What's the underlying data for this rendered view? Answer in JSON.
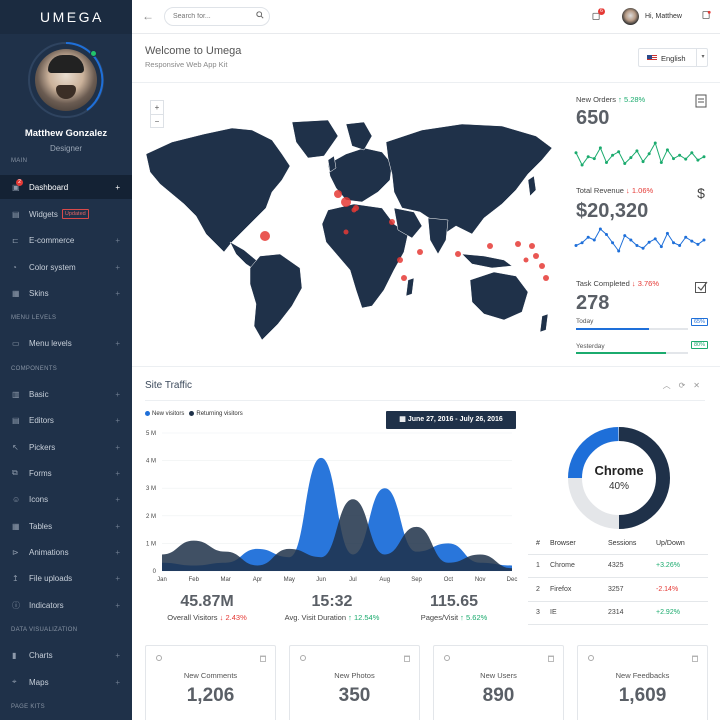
{
  "brand": "UMEGA",
  "profile": {
    "name": "Matthew Gonzalez",
    "role": "Designer"
  },
  "sidebar": {
    "sections": {
      "main": "MAIN",
      "menu_levels": "MENU LEVELS",
      "components": "COMPONENTS",
      "data_visualization": "DATA VISUALIZATION",
      "page_kits": "PAGE KITS"
    },
    "items": [
      {
        "label": "Dashboard",
        "icon": "dashboard-icon",
        "badge": "2",
        "active": true
      },
      {
        "label": "Widgets",
        "icon": "widgets-icon",
        "tag": "Updated"
      },
      {
        "label": "E-commerce",
        "icon": "cart-icon"
      },
      {
        "label": "Color system",
        "icon": "palette-icon"
      },
      {
        "label": "Skins",
        "icon": "skins-icon"
      },
      {
        "label": "Menu levels",
        "icon": "folder-icon"
      },
      {
        "label": "Basic",
        "icon": "basic-icon"
      },
      {
        "label": "Editors",
        "icon": "editor-icon"
      },
      {
        "label": "Pickers",
        "icon": "picker-icon"
      },
      {
        "label": "Forms",
        "icon": "forms-icon"
      },
      {
        "label": "Icons",
        "icon": "smiley-icon"
      },
      {
        "label": "Tables",
        "icon": "table-icon"
      },
      {
        "label": "Animations",
        "icon": "animation-icon"
      },
      {
        "label": "File uploads",
        "icon": "upload-icon"
      },
      {
        "label": "Indicators",
        "icon": "info-icon"
      },
      {
        "label": "Charts",
        "icon": "chart-icon"
      },
      {
        "label": "Maps",
        "icon": "map-pin-icon"
      }
    ]
  },
  "topbar": {
    "search_placeholder": "Search for...",
    "notification_count": "6",
    "greeting": "Hi, Matthew"
  },
  "welcome": {
    "title": "Welcome to Umega",
    "subtitle": "Responsive Web App Kit",
    "language": "English"
  },
  "stats": {
    "new_orders": {
      "label": "New Orders",
      "change": "5.28%",
      "value": "650",
      "sparkline": [
        60,
        35,
        52,
        48,
        70,
        40,
        55,
        62,
        38,
        50,
        64,
        42,
        58,
        80,
        40,
        66,
        48,
        55,
        47,
        60,
        45,
        52
      ]
    },
    "total_revenue": {
      "label": "Total Revenue",
      "change": "1.06%",
      "value": "$20,320",
      "sparkline": [
        40,
        45,
        55,
        50,
        70,
        60,
        45,
        30,
        58,
        50,
        40,
        35,
        46,
        52,
        38,
        62,
        45,
        40,
        55,
        48,
        42,
        50
      ]
    },
    "task_completed": {
      "label": "Task Completed",
      "change": "3.76%",
      "value": "278",
      "today": {
        "label": "Today",
        "percent": "65%",
        "fraction": 0.65
      },
      "yesterday": {
        "label": "Yesterday",
        "percent": "80%",
        "fraction": 0.8
      }
    }
  },
  "traffic": {
    "title": "Site Traffic",
    "legend": {
      "new": "New visitors",
      "returning": "Returning visitors"
    },
    "date_range": "June 27, 2016 - July 26, 2016",
    "kpis": [
      {
        "value": "45.87M",
        "label": "Overall Visitors",
        "change": "2.43%",
        "dir": "down"
      },
      {
        "value": "15:32",
        "label": "Avg. Visit Duration",
        "change": "12.54%",
        "dir": "up"
      },
      {
        "value": "115.65",
        "label": "Pages/Visit",
        "change": "5.62%",
        "dir": "up"
      }
    ],
    "donut": {
      "label": "Chrome",
      "percent": "40%",
      "fraction": 0.4
    },
    "table": {
      "headers": [
        "#",
        "Browser",
        "Sessions",
        "Up/Down"
      ],
      "rows": [
        {
          "n": "1",
          "browser": "Chrome",
          "sessions": "4325",
          "change": "+3.26%",
          "dir": "up"
        },
        {
          "n": "2",
          "browser": "Firefox",
          "sessions": "3257",
          "change": "-2.14%",
          "dir": "down"
        },
        {
          "n": "3",
          "browser": "IE",
          "sessions": "2314",
          "change": "+2.92%",
          "dir": "up"
        }
      ]
    }
  },
  "chart_data": {
    "type": "area",
    "x": [
      "Jan",
      "Feb",
      "Mar",
      "Apr",
      "May",
      "Jun",
      "Jul",
      "Aug",
      "Sep",
      "Oct",
      "Nov",
      "Dec"
    ],
    "y_ticks": [
      "0",
      "1 M",
      "2 M",
      "3 M",
      "4 M",
      "5 M"
    ],
    "ylim": [
      0,
      5
    ],
    "series": [
      {
        "name": "New visitors",
        "color": "#1e6fd9",
        "values": [
          0.3,
          0.2,
          0.3,
          0.8,
          0.5,
          4.1,
          0.6,
          3.0,
          0.7,
          1.0,
          0.3,
          0.2
        ]
      },
      {
        "name": "Returning visitors",
        "color": "#1f3149",
        "values": [
          0.6,
          1.1,
          0.7,
          0.2,
          0.8,
          0.5,
          2.6,
          0.6,
          1.6,
          0.3,
          0.6,
          0.1
        ]
      }
    ]
  },
  "cards": [
    {
      "label": "New Comments",
      "value": "1,206"
    },
    {
      "label": "New Photos",
      "value": "350"
    },
    {
      "label": "New Users",
      "value": "890"
    },
    {
      "label": "New Feedbacks",
      "value": "1,609"
    }
  ],
  "colors": {
    "sidebar": "#1f3149",
    "accent": "#1e6fd9",
    "up": "#1bab6e",
    "down": "#e53935",
    "map_land": "#1f3149",
    "map_marker": "#e53935"
  }
}
